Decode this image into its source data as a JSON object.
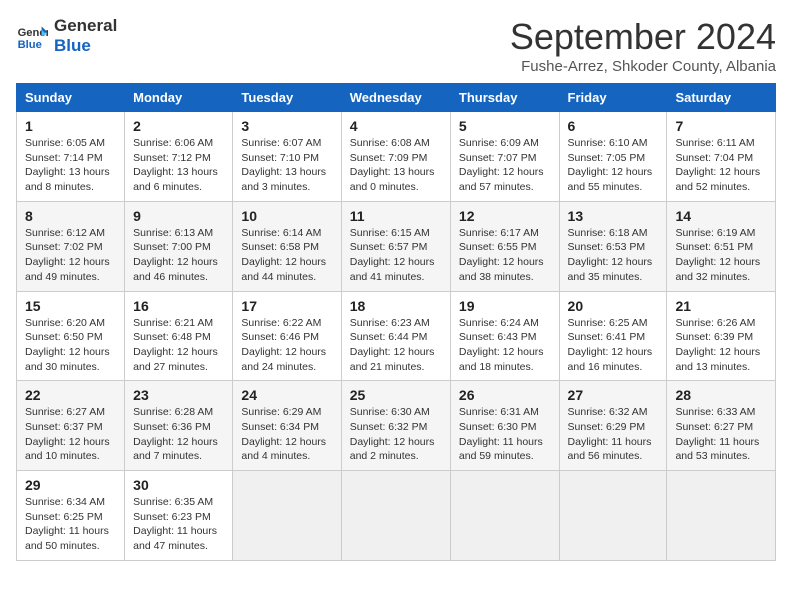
{
  "logo": {
    "text_general": "General",
    "text_blue": "Blue"
  },
  "header": {
    "month_year": "September 2024",
    "location": "Fushe-Arrez, Shkoder County, Albania"
  },
  "weekdays": [
    "Sunday",
    "Monday",
    "Tuesday",
    "Wednesday",
    "Thursday",
    "Friday",
    "Saturday"
  ],
  "weeks": [
    [
      {
        "day": "1",
        "info": "Sunrise: 6:05 AM\nSunset: 7:14 PM\nDaylight: 13 hours and 8 minutes."
      },
      {
        "day": "2",
        "info": "Sunrise: 6:06 AM\nSunset: 7:12 PM\nDaylight: 13 hours and 6 minutes."
      },
      {
        "day": "3",
        "info": "Sunrise: 6:07 AM\nSunset: 7:10 PM\nDaylight: 13 hours and 3 minutes."
      },
      {
        "day": "4",
        "info": "Sunrise: 6:08 AM\nSunset: 7:09 PM\nDaylight: 13 hours and 0 minutes."
      },
      {
        "day": "5",
        "info": "Sunrise: 6:09 AM\nSunset: 7:07 PM\nDaylight: 12 hours and 57 minutes."
      },
      {
        "day": "6",
        "info": "Sunrise: 6:10 AM\nSunset: 7:05 PM\nDaylight: 12 hours and 55 minutes."
      },
      {
        "day": "7",
        "info": "Sunrise: 6:11 AM\nSunset: 7:04 PM\nDaylight: 12 hours and 52 minutes."
      }
    ],
    [
      {
        "day": "8",
        "info": "Sunrise: 6:12 AM\nSunset: 7:02 PM\nDaylight: 12 hours and 49 minutes."
      },
      {
        "day": "9",
        "info": "Sunrise: 6:13 AM\nSunset: 7:00 PM\nDaylight: 12 hours and 46 minutes."
      },
      {
        "day": "10",
        "info": "Sunrise: 6:14 AM\nSunset: 6:58 PM\nDaylight: 12 hours and 44 minutes."
      },
      {
        "day": "11",
        "info": "Sunrise: 6:15 AM\nSunset: 6:57 PM\nDaylight: 12 hours and 41 minutes."
      },
      {
        "day": "12",
        "info": "Sunrise: 6:17 AM\nSunset: 6:55 PM\nDaylight: 12 hours and 38 minutes."
      },
      {
        "day": "13",
        "info": "Sunrise: 6:18 AM\nSunset: 6:53 PM\nDaylight: 12 hours and 35 minutes."
      },
      {
        "day": "14",
        "info": "Sunrise: 6:19 AM\nSunset: 6:51 PM\nDaylight: 12 hours and 32 minutes."
      }
    ],
    [
      {
        "day": "15",
        "info": "Sunrise: 6:20 AM\nSunset: 6:50 PM\nDaylight: 12 hours and 30 minutes."
      },
      {
        "day": "16",
        "info": "Sunrise: 6:21 AM\nSunset: 6:48 PM\nDaylight: 12 hours and 27 minutes."
      },
      {
        "day": "17",
        "info": "Sunrise: 6:22 AM\nSunset: 6:46 PM\nDaylight: 12 hours and 24 minutes."
      },
      {
        "day": "18",
        "info": "Sunrise: 6:23 AM\nSunset: 6:44 PM\nDaylight: 12 hours and 21 minutes."
      },
      {
        "day": "19",
        "info": "Sunrise: 6:24 AM\nSunset: 6:43 PM\nDaylight: 12 hours and 18 minutes."
      },
      {
        "day": "20",
        "info": "Sunrise: 6:25 AM\nSunset: 6:41 PM\nDaylight: 12 hours and 16 minutes."
      },
      {
        "day": "21",
        "info": "Sunrise: 6:26 AM\nSunset: 6:39 PM\nDaylight: 12 hours and 13 minutes."
      }
    ],
    [
      {
        "day": "22",
        "info": "Sunrise: 6:27 AM\nSunset: 6:37 PM\nDaylight: 12 hours and 10 minutes."
      },
      {
        "day": "23",
        "info": "Sunrise: 6:28 AM\nSunset: 6:36 PM\nDaylight: 12 hours and 7 minutes."
      },
      {
        "day": "24",
        "info": "Sunrise: 6:29 AM\nSunset: 6:34 PM\nDaylight: 12 hours and 4 minutes."
      },
      {
        "day": "25",
        "info": "Sunrise: 6:30 AM\nSunset: 6:32 PM\nDaylight: 12 hours and 2 minutes."
      },
      {
        "day": "26",
        "info": "Sunrise: 6:31 AM\nSunset: 6:30 PM\nDaylight: 11 hours and 59 minutes."
      },
      {
        "day": "27",
        "info": "Sunrise: 6:32 AM\nSunset: 6:29 PM\nDaylight: 11 hours and 56 minutes."
      },
      {
        "day": "28",
        "info": "Sunrise: 6:33 AM\nSunset: 6:27 PM\nDaylight: 11 hours and 53 minutes."
      }
    ],
    [
      {
        "day": "29",
        "info": "Sunrise: 6:34 AM\nSunset: 6:25 PM\nDaylight: 11 hours and 50 minutes."
      },
      {
        "day": "30",
        "info": "Sunrise: 6:35 AM\nSunset: 6:23 PM\nDaylight: 11 hours and 47 minutes."
      },
      {
        "day": "",
        "info": ""
      },
      {
        "day": "",
        "info": ""
      },
      {
        "day": "",
        "info": ""
      },
      {
        "day": "",
        "info": ""
      },
      {
        "day": "",
        "info": ""
      }
    ]
  ]
}
